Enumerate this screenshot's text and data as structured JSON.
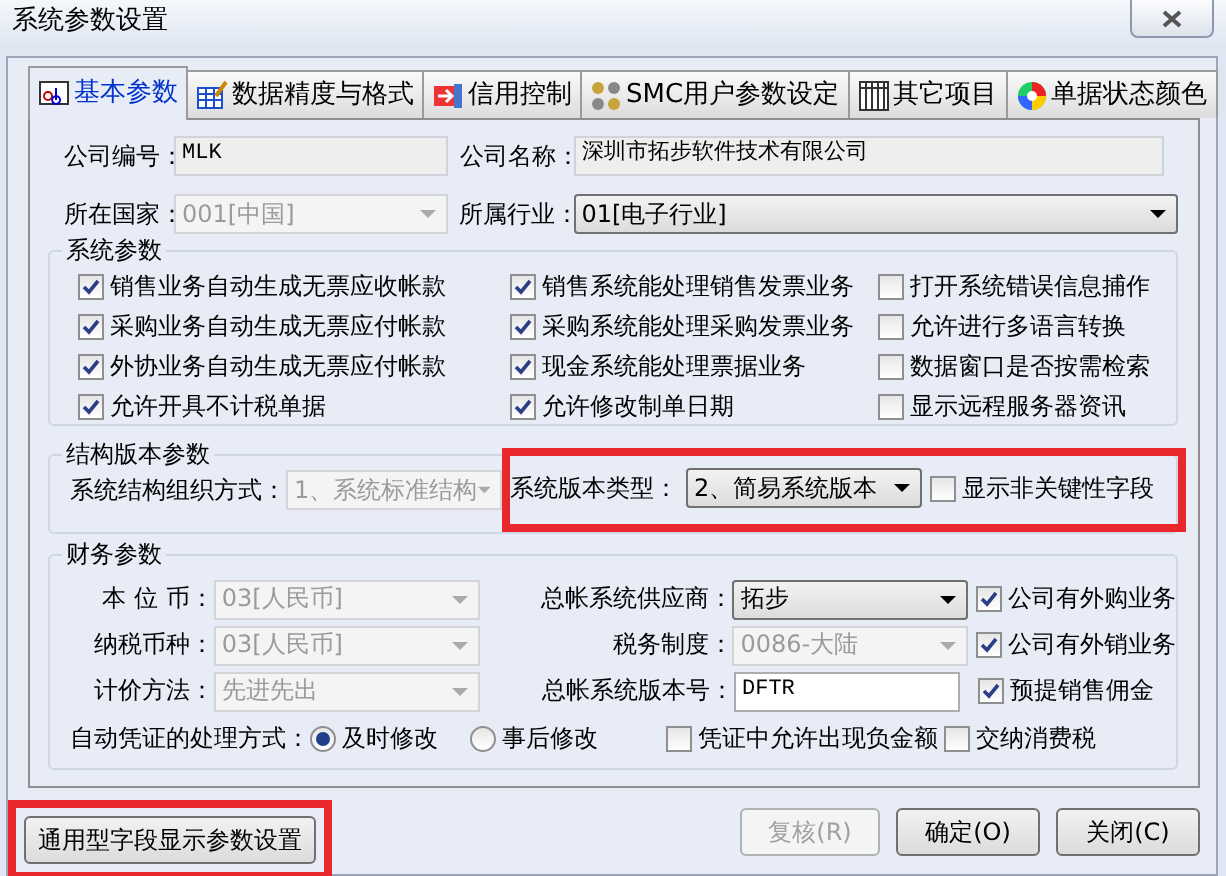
{
  "window": {
    "title": "系统参数设置"
  },
  "tabs": [
    {
      "label": "基本参数",
      "selected": true,
      "kind": "text"
    },
    {
      "label": "数据精度与格式",
      "selected": false,
      "kind": "sheet"
    },
    {
      "label": "信用控制",
      "selected": false,
      "kind": "door"
    },
    {
      "label": "SMC用户参数设定",
      "selected": false,
      "kind": "gears"
    },
    {
      "label": "其它项目",
      "selected": false,
      "kind": "table"
    },
    {
      "label": "单据状态颜色",
      "selected": false,
      "kind": "palette"
    }
  ],
  "header_fields": [
    {
      "label": "公司编号：",
      "kind": "text",
      "value": "MLK",
      "disabled": true
    },
    {
      "label": "公司名称：",
      "kind": "text",
      "value": "深圳市拓步软件技术有限公司",
      "disabled": true
    },
    {
      "label": "所在国家：",
      "kind": "combo",
      "value": "001[中国]",
      "disabled": true
    },
    {
      "label": "所属行业：",
      "kind": "combo",
      "value": "01[电子行业]",
      "disabled": false
    }
  ],
  "system_params": {
    "title": "系统参数",
    "columns": [
      [
        {
          "label": "销售业务自动生成无票应收帐款",
          "checked": true
        },
        {
          "label": "采购业务自动生成无票应付帐款",
          "checked": true
        },
        {
          "label": "外协业务自动生成无票应付帐款",
          "checked": true
        },
        {
          "label": "允许开具不计税单据",
          "checked": true
        }
      ],
      [
        {
          "label": "销售系统能处理销售发票业务",
          "checked": true
        },
        {
          "label": "采购系统能处理采购发票业务",
          "checked": true
        },
        {
          "label": "现金系统能处理票据业务",
          "checked": true
        },
        {
          "label": "允许修改制单日期",
          "checked": true
        }
      ],
      [
        {
          "label": "打开系统错误信息捕作",
          "checked": false
        },
        {
          "label": "允许进行多语言转换",
          "checked": false
        },
        {
          "label": "数据窗口是否按需检索",
          "checked": false
        },
        {
          "label": "显示远程服务器资讯",
          "checked": false
        }
      ]
    ]
  },
  "structure": {
    "title": "结构版本参数",
    "org_label": "系统结构组织方式：",
    "org_combo": {
      "value": "1、系统标准结构",
      "disabled": true
    },
    "highlighted": true,
    "version_label": "系统版本类型：",
    "version_combo": {
      "value": "2、简易系统版本",
      "disabled": false
    },
    "checkbox": {
      "label": "显示非关键性字段",
      "checked": false
    }
  },
  "finance": {
    "title": "财务参数",
    "rows": [
      {
        "left": {
          "label": "本 位 币：",
          "value": "03[人民币]",
          "disabled": true
        },
        "mid": {
          "label": "总帐系统供应商：",
          "kind": "combo",
          "value": "拓步",
          "disabled": false
        },
        "check": {
          "label": "公司有外购业务",
          "checked": true
        }
      },
      {
        "left": {
          "label": "纳税币种：",
          "value": "03[人民币]",
          "disabled": true
        },
        "mid": {
          "label": "税务制度：",
          "kind": "combo",
          "value": "0086-大陆",
          "disabled": true
        },
        "check": {
          "label": "公司有外销业务",
          "checked": true
        }
      },
      {
        "left": {
          "label": "计价方法：",
          "value": "先进先出",
          "disabled": true
        },
        "mid": {
          "label": "总帐系统版本号：",
          "kind": "text",
          "value": "DFTR",
          "disabled": false
        },
        "check": {
          "label": "预提销售佣金",
          "checked": true
        }
      }
    ],
    "voucher_label": "自动凭证的处理方式：",
    "radios": [
      {
        "label": "及时修改",
        "selected": true
      },
      {
        "label": "事后修改",
        "selected": false
      }
    ],
    "voucher_checks": [
      {
        "label": "凭证中允许出现负金额",
        "checked": false
      },
      {
        "label": "交纳消费税",
        "checked": false
      }
    ]
  },
  "buttons": [
    {
      "label": "通用型字段显示参数设置",
      "disabled": false,
      "highlighted": true
    },
    {
      "label": "复核(R)",
      "disabled": true,
      "highlighted": false
    },
    {
      "label": "确定(O)",
      "disabled": false,
      "highlighted": false
    },
    {
      "label": "关闭(C)",
      "disabled": false,
      "highlighted": false
    }
  ]
}
